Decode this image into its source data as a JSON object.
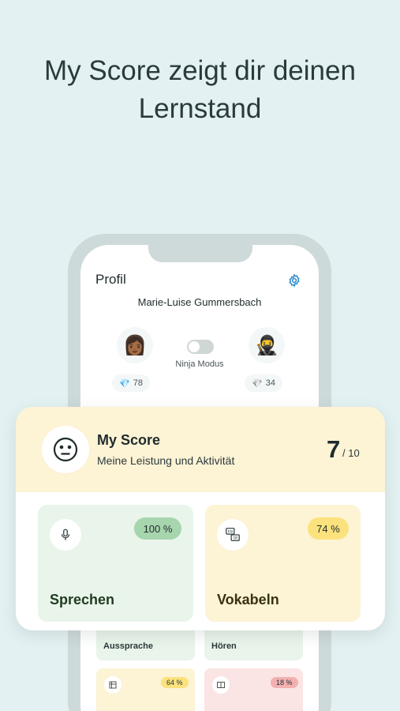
{
  "headline": {
    "line1": "My Score zeigt dir deinen",
    "line2": "Lernstand"
  },
  "profile": {
    "title": "Profil",
    "username": "Marie-Luise Gummersbach",
    "ninja_label": "Ninja Modus",
    "ninja_mode_on": false,
    "left_gems": "78",
    "right_gems": "34",
    "left_avatar": "👩🏾",
    "right_avatar": "🥷"
  },
  "score_card": {
    "title": "My Score",
    "subtitle": "Meine Leistung und Aktivität",
    "value": "7",
    "denominator": "/ 10",
    "tiles": [
      {
        "label": "Sprechen",
        "percent": "100 %"
      },
      {
        "label": "Vokabeln",
        "percent": "74 %"
      }
    ]
  },
  "lower_tiles": [
    {
      "label": "Aussprache"
    },
    {
      "label": "Hören"
    },
    {
      "percent": "64 %"
    },
    {
      "percent": "18 %"
    }
  ],
  "colors": {
    "background": "#e3f1f2",
    "green_tile": "#e9f4ea",
    "yellow_tile": "#fdf3d5",
    "red_tile": "#fbe4e4",
    "accent_blue": "#2f8ccf"
  }
}
